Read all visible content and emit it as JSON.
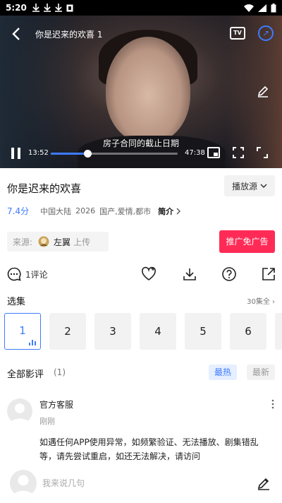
{
  "status_bar": {
    "time": "5:20",
    "left_icons": [
      "download-icon",
      "download-icon",
      "download-icon",
      "notification-box-icon"
    ],
    "right_icons": [
      "wifi-icon",
      "signal-icon",
      "battery-icon"
    ]
  },
  "player": {
    "title": "你是迟来的欢喜 1",
    "subtitle": "房子合同的截止日期",
    "current_time": "13:52",
    "total_time": "47:38",
    "tv_label": "TV",
    "progress": 0.29,
    "accent": "#3d7bff"
  },
  "drama": {
    "title": "你是迟来的欢喜",
    "source_label": "播放源",
    "score": "7.4分",
    "region": "中国大陆",
    "year": "2026",
    "genre": "国产,爱情,都市",
    "intro_label": "简介"
  },
  "uploader": {
    "source_label": "来源:",
    "name": "左翼",
    "action": "上传"
  },
  "ad_free_button": {
    "label": "推广免广告",
    "color": "#ff2b56"
  },
  "actions": {
    "comment_count": "1评论",
    "icons": [
      "favorite-add-icon",
      "download-icon",
      "help-icon",
      "share-icon"
    ]
  },
  "episodes": {
    "label": "选集",
    "total": "30集全 ›",
    "items": [
      "1",
      "2",
      "3",
      "4",
      "5",
      "6"
    ],
    "active_index": 0
  },
  "comments": {
    "label": "全部影评",
    "count": "(1)",
    "sort_hot": "最热",
    "sort_new": "最新",
    "items": [
      {
        "name": "官方客服",
        "time": "刚刚",
        "text": "如遇任何APP使用异常，如频繁验证、无法播放、剧集错乱等，请先尝试重启，如还无法解决，请访问"
      }
    ]
  },
  "bottom_bar": {
    "placeholder": "我来说几句"
  }
}
